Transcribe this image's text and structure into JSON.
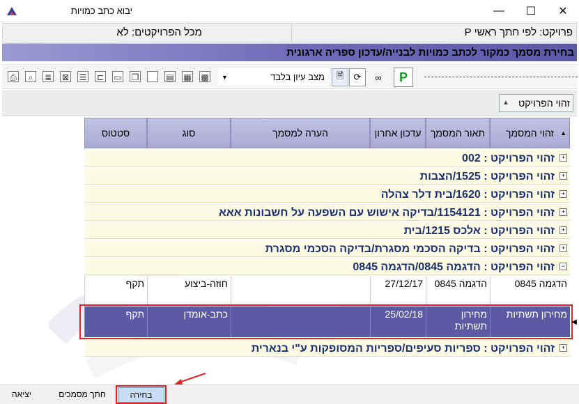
{
  "window": {
    "title": "יבוא כתב כמויות",
    "controls": {
      "minimize": "—",
      "maximize": "☐",
      "close": "✕"
    }
  },
  "infobar": {
    "project": "פרויקט: לפי חתך ראשי P",
    "all_projects": "מכל הפרויקטים: לא"
  },
  "banner": "בחירת מסמך כמקור לכתב כמויות לבנייה/עדכון ספריה ארגונית",
  "toolbar": {
    "view_mode": "מצב עיון בלבד",
    "p_button": "P"
  },
  "group_chip": "זהוי הפרויקט",
  "grid": {
    "headers": [
      "זהוי המסמך",
      "תאור המסמך",
      "עדכון אחרון",
      "הערה למסמך",
      "סוג",
      "סטטוס"
    ],
    "groups": [
      {
        "text": "זהוי הפרויקט : 002",
        "expander": "+"
      },
      {
        "text": "זהוי הפרויקט : 1525/הצבות",
        "expander": "+"
      },
      {
        "text": "זהוי הפרויקט : 1620/בית דלר צהלה",
        "expander": "+"
      },
      {
        "text": "זהוי הפרויקט : 1154121/בדיקה אישוש עם השפעה על חשבונות   אאא",
        "expander": "+"
      },
      {
        "text": "זהוי הפרויקט : אלכס 1215/בית",
        "expander": "+"
      },
      {
        "text": "זהוי הפרויקט : בדיקה הסכמי מסגרת/בדיקה הסכמי מסגרת",
        "expander": "+"
      },
      {
        "text": "זהוי הפרויקט : הדגמה 0845/הדגמה 0845",
        "expander": "−"
      }
    ],
    "rows": [
      {
        "doc_id": "הדגמה 0845",
        "desc": "הדגמה 0845",
        "updated": "27/12/17",
        "note": "",
        "type": "חוזה-ביצוע",
        "status": "תקף"
      },
      {
        "doc_id": "מחירון תשתיות",
        "desc": "מחירון תשתיות",
        "updated": "25/02/18",
        "note": "",
        "type": "כתב-אומדן",
        "status": "תקף"
      }
    ],
    "last_group": {
      "text": "זהוי הפרויקט : ספריות סעיפים/ספריות המסופקות ע\"י בנארית",
      "expander": "+"
    }
  },
  "bottom": {
    "exit": "יציאה",
    "search_docs": "חתך מסמכים",
    "select": "בחירה"
  },
  "colors": {
    "banner_start": "#9a9ad4",
    "banner_end": "#5a5aa8",
    "group_bg": "#fdfbe4",
    "group_text": "#1a2f6e",
    "selected_row": "#5b5ba3",
    "annotation_red": "#e02424",
    "primary_button": "#c9def6"
  },
  "icons": [
    "app-icon",
    "printer-icon",
    "print-preview-icon",
    "document-icon",
    "excel-icon",
    "columns-icon",
    "tree-icon",
    "folder-icon",
    "copy-icon",
    "blank-page-icon",
    "report-icon",
    "filter-icon",
    "grid-icon",
    "page-icon",
    "refresh-icon",
    "binoculars-icon"
  ]
}
